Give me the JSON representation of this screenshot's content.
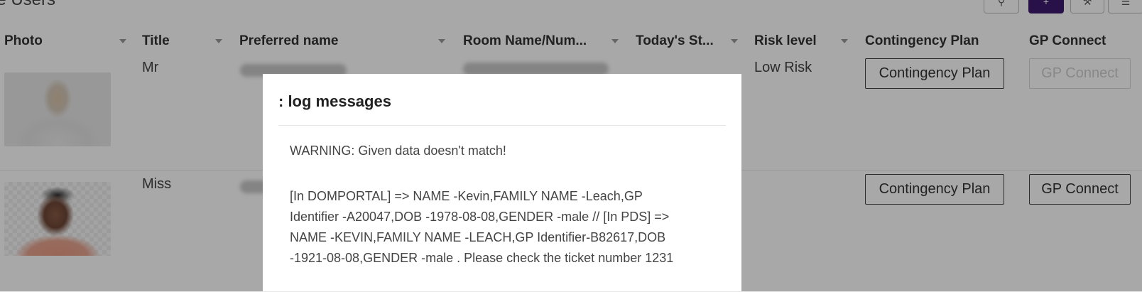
{
  "header": {
    "title": "ice Users",
    "buttons": [
      {
        "name": "search-button",
        "icon": "search-icon"
      },
      {
        "name": "add-button",
        "icon": "plus-icon"
      },
      {
        "name": "tool-button",
        "icon": "wrench-icon"
      },
      {
        "name": "menu-button",
        "icon": "hamburger-icon"
      }
    ]
  },
  "table": {
    "columns": [
      "Photo",
      "Title",
      "Preferred name",
      "Room Name/Num...",
      "Today's St...",
      "Risk level",
      "Contingency Plan",
      "GP Connect"
    ],
    "rows": [
      {
        "title": "Mr",
        "risk_level": "Low Risk",
        "contingency_label": "Contingency Plan",
        "gp_label": "GP Connect",
        "gp_disabled": true
      },
      {
        "title": "Miss",
        "risk_level": "",
        "contingency_label": "Contingency Plan",
        "gp_label": "GP Connect",
        "gp_disabled": false
      }
    ]
  },
  "modal": {
    "title": ": log messages",
    "warning": "WARNING: Given data doesn't match!",
    "body_lines": [
      "[In DOMPORTAL] => NAME -Kevin,FAMILY NAME -Leach,GP",
      "Identifier -A20047,DOB -1978-08-08,GENDER -male // [In PDS] =>",
      "NAME -KEVIN,FAMILY NAME -LEACH,GP Identifier-B82617,DOB",
      "-1921-08-08,GENDER -male . Please check the ticket number 1231"
    ]
  },
  "colors": {
    "accent": "#3d1a6e",
    "overlay": "rgba(0,0,0,0.34)"
  }
}
